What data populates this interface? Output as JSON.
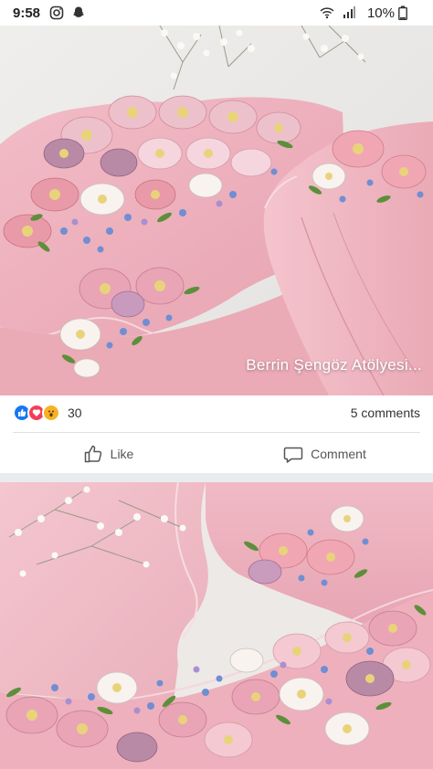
{
  "status_bar": {
    "time": "9:58",
    "battery": "10%",
    "icons": [
      "instagram-icon",
      "snapchat-icon",
      "wifi-icon",
      "signal-icon",
      "battery-icon"
    ]
  },
  "post": {
    "image_caption": "Berrin Şengöz Atölyesi...",
    "reaction_count": "30",
    "comments_count": "5 comments",
    "reactions": [
      "like",
      "love",
      "wow"
    ],
    "like_label": "Like",
    "comment_label": "Comment"
  },
  "colors": {
    "like_blue": "#1877f2",
    "love_red": "#f33e58",
    "wow_yellow": "#f7b125",
    "fabric_pink": "#f2b8c2",
    "divider": "#dddfe2"
  }
}
